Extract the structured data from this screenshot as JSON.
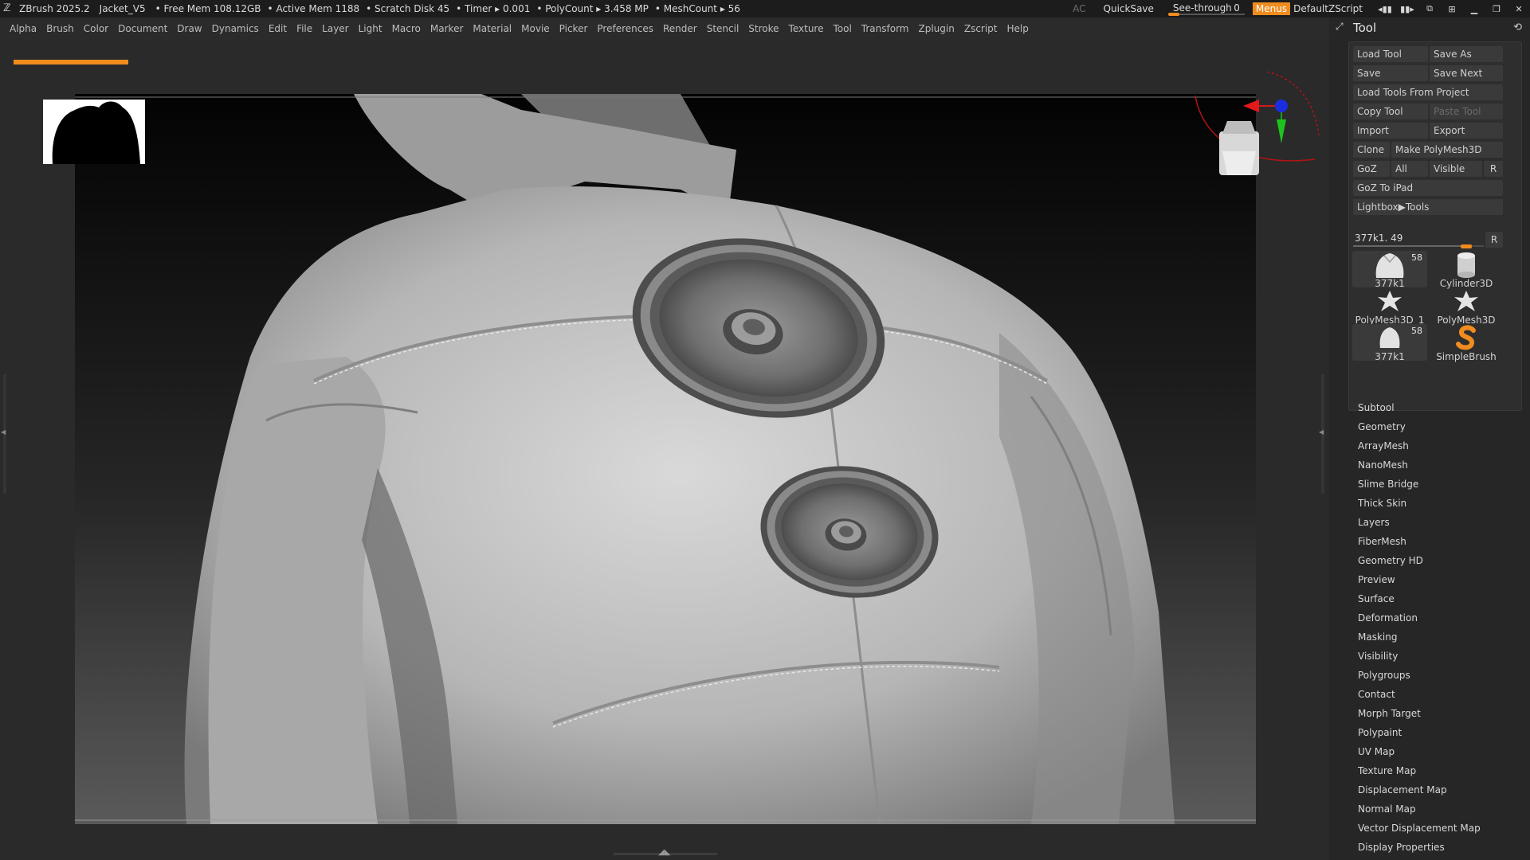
{
  "titlebar": {
    "app": "ZBrush 2025.2",
    "document": "Jacket_V5",
    "stats": [
      "• Free Mem 108.12GB",
      "• Active Mem 1188",
      "• Scratch Disk 45",
      "• Timer ▸ 0.001",
      "• PolyCount ▸ 3.458 MP",
      "• MeshCount ▸ 56"
    ],
    "ac": "AC",
    "quicksave": "QuickSave",
    "see_through": {
      "label": "See-through",
      "value": "0"
    },
    "menus": "Menus",
    "default_zscript": "DefaultZScript",
    "icons": [
      "palette-left-icon",
      "palette-right-icon",
      "window-swap-icon",
      "window-tile-icon",
      "minimize-icon",
      "restore-icon",
      "close-icon"
    ]
  },
  "menubar": {
    "items": [
      "Alpha",
      "Brush",
      "Color",
      "Document",
      "Draw",
      "Dynamics",
      "Edit",
      "File",
      "Layer",
      "Light",
      "Macro",
      "Marker",
      "Material",
      "Movie",
      "Picker",
      "Preferences",
      "Render",
      "Stencil",
      "Stroke",
      "Texture",
      "Tool",
      "Transform",
      "Zplugin",
      "Zscript",
      "Help"
    ]
  },
  "tool_palette": {
    "title": "Tool",
    "buttons": {
      "load_tool": "Load Tool",
      "save_as": "Save As",
      "save": "Save",
      "save_next": "Save Next",
      "load_from_project": "Load Tools From Project",
      "copy_tool": "Copy Tool",
      "paste_tool": "Paste Tool",
      "import": "Import",
      "export": "Export",
      "clone": "Clone",
      "make_polymesh": "Make PolyMesh3D",
      "goz": "GoZ",
      "all": "All",
      "visible": "Visible",
      "r": "R",
      "goz_ipad": "GoZ To iPad",
      "lightbox_tools": "Lightbox▶Tools"
    },
    "slider": {
      "label": "377k1. 49",
      "r": "R",
      "level": 0.9
    },
    "tools": [
      {
        "name": "377k1",
        "count": "58",
        "icon": "jacket-tool-icon",
        "selected": true
      },
      {
        "name": "Cylinder3D",
        "count": "",
        "icon": "cylinder-tool-icon",
        "selected": false
      },
      {
        "name": "PolyMesh3D",
        "count": "",
        "icon": "polymesh-star-icon",
        "selected": false
      },
      {
        "name": "PolyMesh3D_1",
        "count": "",
        "icon": "polymesh-star-icon",
        "selected": false
      },
      {
        "name": "SimpleBrush",
        "count": "",
        "icon": "simplebrush-icon",
        "selected": false
      },
      {
        "name": "377k1",
        "count": "58",
        "icon": "jacket-tool-icon",
        "selected": false
      }
    ],
    "subpalettes": [
      "Subtool",
      "Geometry",
      "ArrayMesh",
      "NanoMesh",
      "Slime Bridge",
      "Thick Skin",
      "Layers",
      "FiberMesh",
      "Geometry HD",
      "Preview",
      "Surface",
      "Deformation",
      "Masking",
      "Visibility",
      "Polygroups",
      "Contact",
      "Morph Target",
      "Polypaint",
      "UV Map",
      "Texture Map",
      "Displacement Map",
      "Normal Map",
      "Vector Displacement Map",
      "Display Properties"
    ]
  },
  "colors": {
    "accent": "#f08c1e",
    "panel": "#2e2e2e",
    "background": "#262626"
  }
}
